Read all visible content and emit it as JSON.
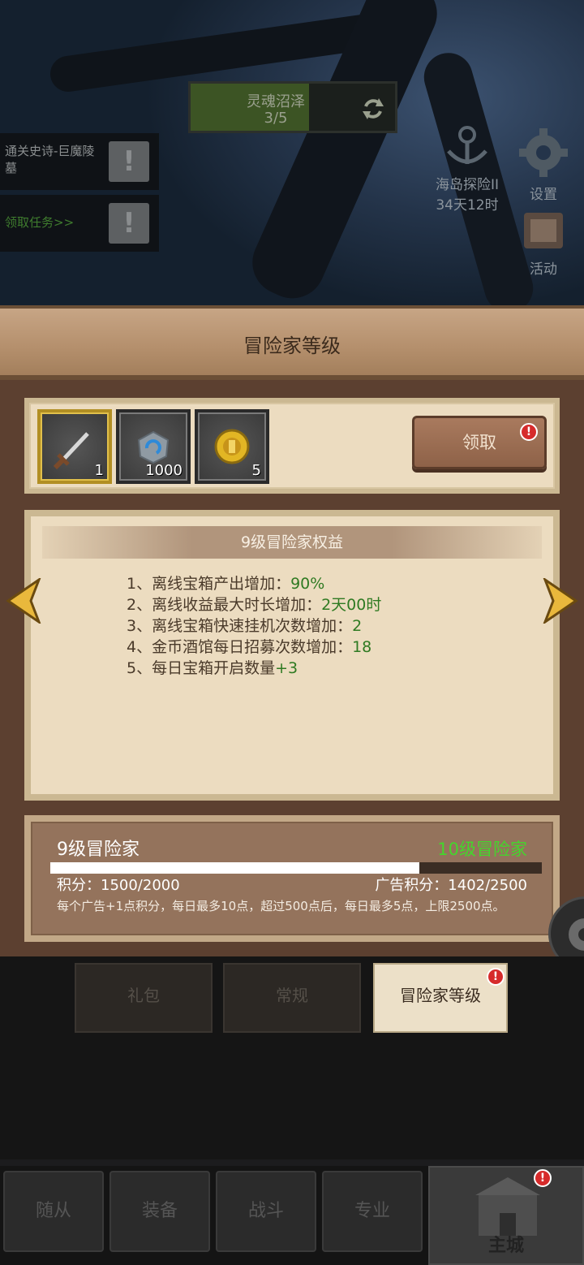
{
  "quest": {
    "name": "灵魂沼泽",
    "progress": "3/5"
  },
  "side_tasks": [
    {
      "label": "通关史诗-巨魔陵墓"
    },
    {
      "label": "领取任务>>"
    }
  ],
  "top_icons": {
    "island": {
      "label": "海岛探险II",
      "timer": "34天12时"
    },
    "settings": {
      "label": "设置"
    },
    "events": {
      "label": "活动"
    }
  },
  "panel": {
    "title": "冒险家等级"
  },
  "rewards": {
    "items": [
      {
        "icon": "sword-icon",
        "qty": "1"
      },
      {
        "icon": "rune-stone-icon",
        "qty": "1000"
      },
      {
        "icon": "gold-medal-icon",
        "qty": "5"
      }
    ],
    "claim_label": "领取",
    "alert": "!"
  },
  "benefits": {
    "heading": "9级冒险家权益",
    "rows": [
      {
        "text": "1、离线宝箱产出增加：",
        "value": "90%"
      },
      {
        "text": "2、离线收益最大时长增加：",
        "value": "2天00时"
      },
      {
        "text": "3、离线宝箱快速挂机次数增加：",
        "value": "2"
      },
      {
        "text": "4、金币酒馆每日招募次数增加：",
        "value": "18"
      },
      {
        "text": "5、每日宝箱开启数量",
        "value": "+3"
      }
    ]
  },
  "level": {
    "current": "9级冒险家",
    "next": "10级冒险家",
    "progress": 0.75,
    "points": "积分：1500/2000",
    "ad_points": "广告积分：1402/2500",
    "note": "每个广告+1点积分，每日最多10点，超过500点后，每日最多5点，上限2500点。"
  },
  "tabs": [
    {
      "label": "礼包"
    },
    {
      "label": "常规"
    },
    {
      "label": "冒险家等级"
    }
  ],
  "bottom_nav": [
    {
      "label": "随从"
    },
    {
      "label": "装备"
    },
    {
      "label": "战斗"
    },
    {
      "label": "专业"
    },
    {
      "label": "主城"
    }
  ],
  "colors": {
    "green_value": "#2f7a22",
    "next_level_green": "#44d62c",
    "alert_red": "#d62b2b"
  }
}
